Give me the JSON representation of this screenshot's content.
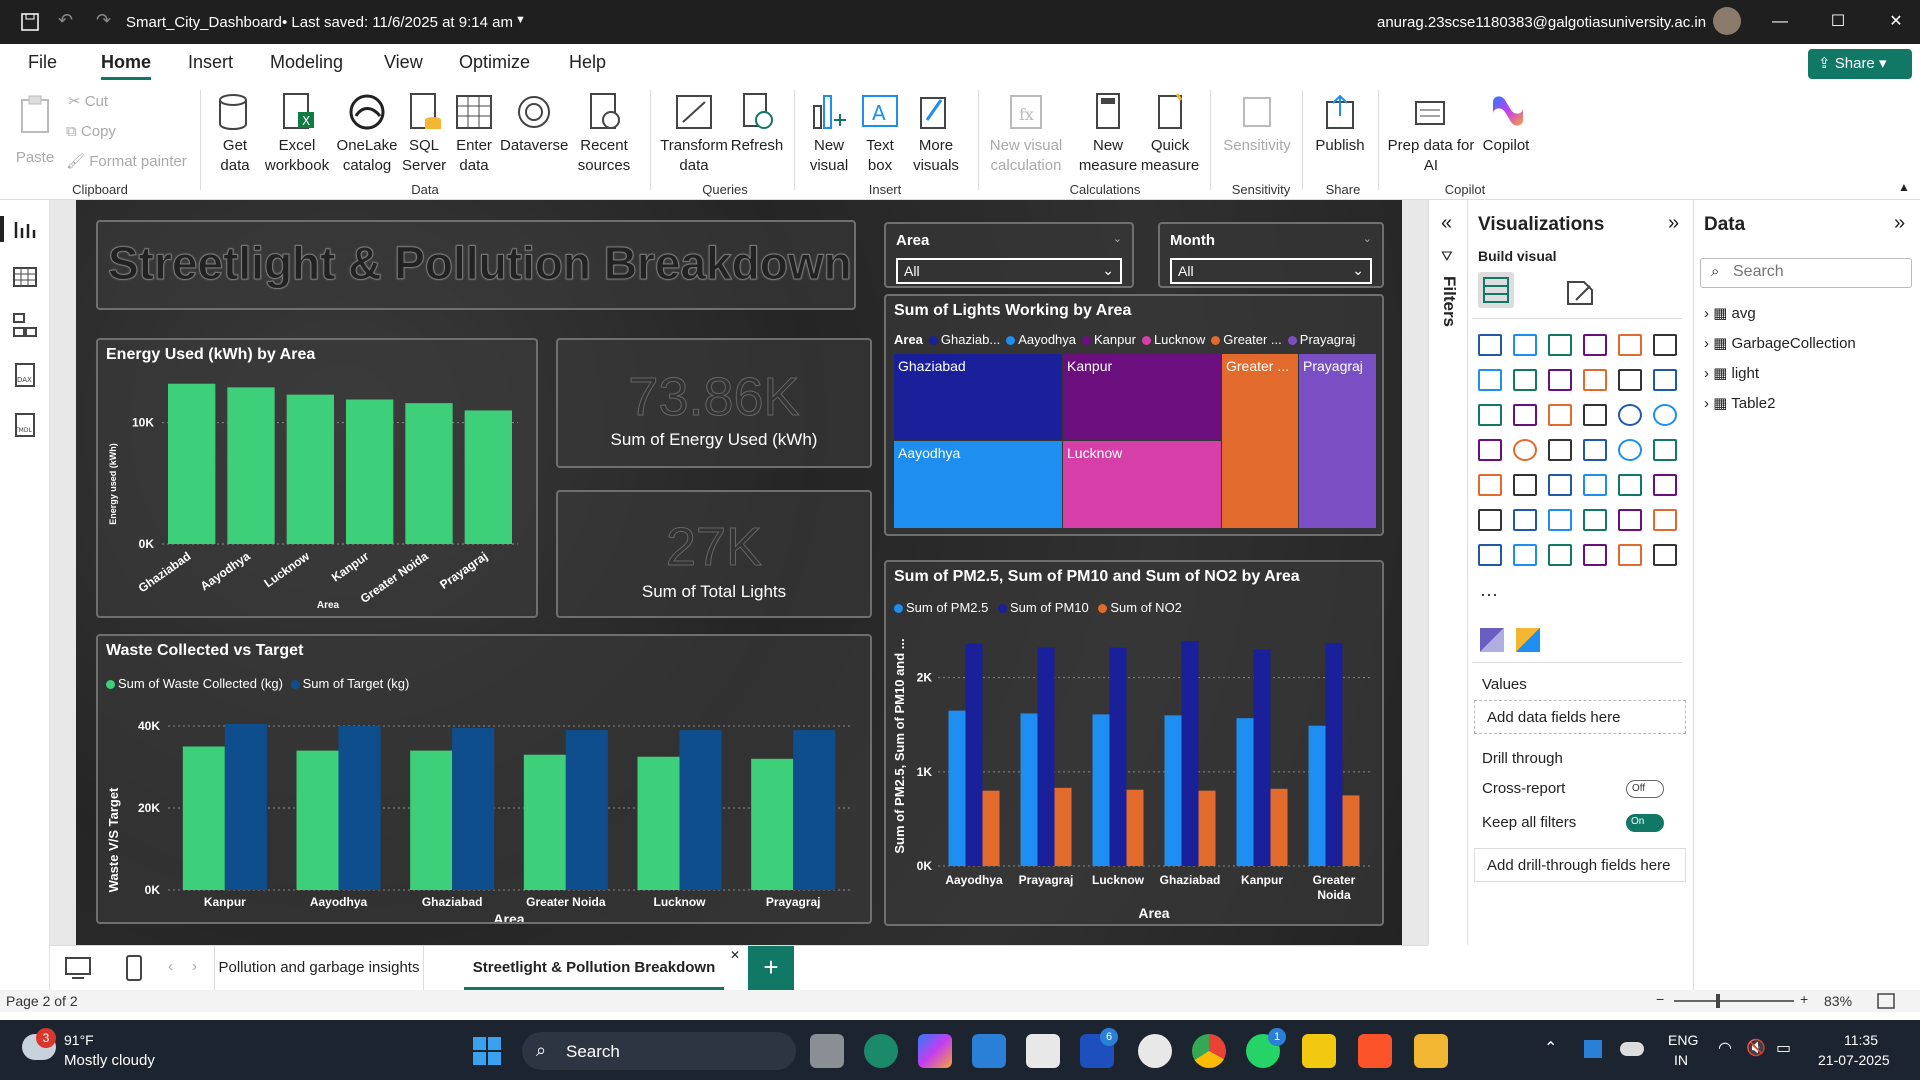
{
  "window": {
    "title": "Smart_City_Dashboard",
    "saved": "• Last saved: 11/6/2025 at 9:14 am",
    "user": "anurag.23scse1180383@galgotiasuniversity.ac.in"
  },
  "menu": [
    "File",
    "Home",
    "Insert",
    "Modeling",
    "View",
    "Optimize",
    "Help"
  ],
  "share": "Share",
  "ribbon": {
    "paste": "Paste",
    "cut": "Cut",
    "copy": "Copy",
    "format_painter": "Format painter",
    "get_data": "Get data",
    "excel": "Excel workbook",
    "onelake": "OneLake catalog",
    "sql": "SQL Server",
    "enter_data": "Enter data",
    "dataverse": "Dataverse",
    "recent": "Recent sources",
    "transform": "Transform data",
    "refresh": "Refresh",
    "new_visual": "New visual",
    "text_box": "Text box",
    "more_visuals": "More visuals",
    "new_visual_calc": "New visual calculation",
    "new_measure": "New measure",
    "quick_measure": "Quick measure",
    "sensitivity": "Sensitivity",
    "publish": "Publish",
    "prep_data": "Prep data for AI",
    "copilot": "Copilot",
    "groups": {
      "clipboard": "Clipboard",
      "data": "Data",
      "queries": "Queries",
      "insert": "Insert",
      "calculations": "Calculations",
      "sensitivity": "Sensitivity",
      "share": "Share",
      "copilot": "Copilot"
    }
  },
  "dashboard": {
    "title": "Streetlight & Pollution Breakdown",
    "kpi_energy": {
      "value": "73.86K",
      "label": "Sum of Energy Used (kWh)"
    },
    "kpi_lights": {
      "value": "27K",
      "label": "Sum of Total Lights"
    },
    "slicer_area": {
      "label": "Area",
      "value": "All"
    },
    "slicer_month": {
      "label": "Month",
      "value": "All"
    }
  },
  "chart_data": [
    {
      "type": "bar",
      "title": "Energy Used (kWh) by Area",
      "xlabel": "Area",
      "ylabel": "Energy used (kWh)",
      "categories": [
        "Ghaziabad",
        "Aayodhya",
        "Lucknow",
        "Kanpur",
        "Greater Noida",
        "Prayagraj"
      ],
      "values": [
        13200,
        12900,
        12300,
        11900,
        11600,
        11000
      ],
      "yticks": [
        "0K",
        "10K"
      ],
      "ylim": [
        0,
        14000
      ],
      "colors": [
        "#3ecf7a"
      ]
    },
    {
      "type": "heatmap",
      "title": "Sum of Lights Working by Area",
      "legend_title": "Area",
      "legend": [
        "Ghaziab...",
        "Aayodhya",
        "Kanpur",
        "Lucknow",
        "Greater ...",
        "Prayagraj"
      ],
      "tiles": [
        {
          "label": "Ghaziabad",
          "color": "#1a1f9a"
        },
        {
          "label": "Kanpur",
          "color": "#6b0f7e"
        },
        {
          "label": "Greater ...",
          "color": "#e26a2c"
        },
        {
          "label": "Prayagraj",
          "color": "#7b4fc4"
        },
        {
          "label": "Aayodhya",
          "color": "#1e8ef0"
        },
        {
          "label": "Lucknow",
          "color": "#d63fa8"
        }
      ],
      "legend_colors": [
        "#1a1f9a",
        "#1e8ef0",
        "#6b0f7e",
        "#d63fa8",
        "#e26a2c",
        "#7b4fc4"
      ]
    },
    {
      "type": "bar",
      "title": "Waste Collected vs Target",
      "xlabel": "Area",
      "ylabel": "Waste V/S Target",
      "categories": [
        "Kanpur",
        "Aayodhya",
        "Ghaziabad",
        "Greater Noida",
        "Lucknow",
        "Prayagraj"
      ],
      "series": [
        {
          "name": "Sum of Waste Collected (kg)",
          "values": [
            35000,
            34000,
            34000,
            33000,
            32500,
            32000
          ],
          "color": "#3ecf7a"
        },
        {
          "name": "Sum of Target (kg)",
          "values": [
            40500,
            40000,
            39500,
            39000,
            39000,
            39000
          ],
          "color": "#0f4e8c"
        }
      ],
      "yticks": [
        "0K",
        "20K",
        "40K"
      ],
      "ylim": [
        0,
        40000
      ]
    },
    {
      "type": "bar",
      "title": "Sum of PM2.5, Sum of PM10 and Sum of NO2 by Area",
      "xlabel": "Area",
      "ylabel": "Sum of PM2.5, Sum of PM10 and ...",
      "categories": [
        "Aayodhya",
        "Prayagraj",
        "Lucknow",
        "Ghaziabad",
        "Kanpur",
        "Greater Noida"
      ],
      "series": [
        {
          "name": "Sum of PM2.5",
          "values": [
            1650,
            1620,
            1610,
            1600,
            1570,
            1490
          ],
          "color": "#1e8ef0"
        },
        {
          "name": "Sum of PM10",
          "values": [
            2360,
            2320,
            2320,
            2390,
            2300,
            2370
          ],
          "color": "#1a1f9a"
        },
        {
          "name": "Sum of NO2",
          "values": [
            800,
            830,
            810,
            800,
            820,
            750
          ],
          "color": "#e26a2c"
        }
      ],
      "yticks": [
        "0K",
        "1K",
        "2K"
      ],
      "ylim": [
        0,
        2400
      ]
    }
  ],
  "viz_pane": {
    "title": "Visualizations",
    "build": "Build visual",
    "values": "Values",
    "add_fields": "Add data fields here",
    "drill": "Drill through",
    "cross_report": "Cross-report",
    "cross_state": "Off",
    "keep_filters": "Keep all filters",
    "keep_state": "On",
    "add_drill": "Add drill-through fields here"
  },
  "filters_label": "Filters",
  "data_pane": {
    "title": "Data",
    "search_placeholder": "Search",
    "tables": [
      "avg",
      "GarbageCollection",
      "light",
      "Table2"
    ]
  },
  "tabs": [
    "Pollution and garbage insights",
    "Streetlight & Pollution Breakdown"
  ],
  "status": {
    "page": "Page 2 of 2",
    "zoom": "83%"
  },
  "taskbar": {
    "weather_temp": "91°F",
    "weather_desc": "Mostly cloudy",
    "search": "Search",
    "lang1": "ENG",
    "lang2": "IN",
    "time": "11:35",
    "date": "21-07-2025",
    "weather_badge": "3",
    "teams_badge": "6",
    "whatsapp_badge": "1"
  }
}
